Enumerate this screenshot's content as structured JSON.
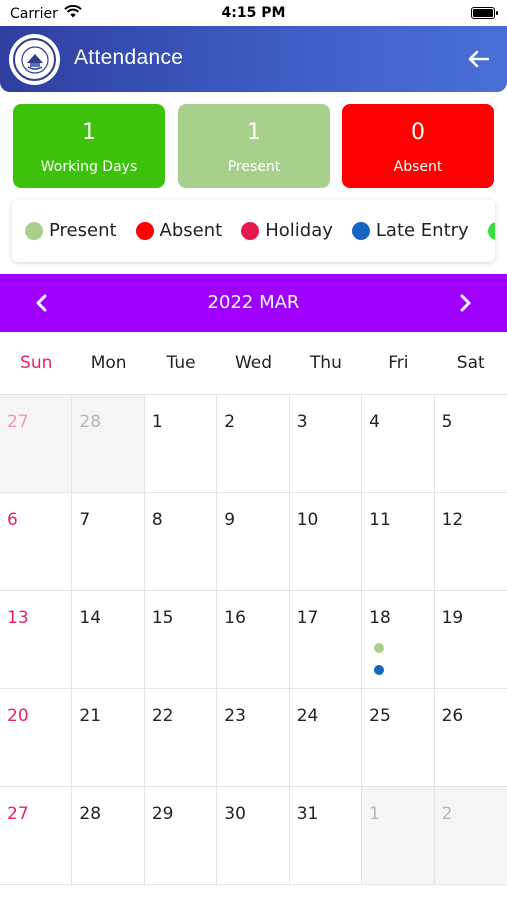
{
  "status_bar": {
    "carrier": "Carrier",
    "time": "4:15 PM"
  },
  "header": {
    "title": "Attendance",
    "logo_icon": "school-seal-icon",
    "back_icon": "arrow-left-icon"
  },
  "summary": [
    {
      "count": "1",
      "label": "Working Days",
      "color": "#3cc20a"
    },
    {
      "count": "1",
      "label": "Present",
      "color": "#a8d08d"
    },
    {
      "count": "0",
      "label": "Absent",
      "color": "#fe0000"
    }
  ],
  "legend": [
    {
      "label": "Present",
      "color": "#a8d08d"
    },
    {
      "label": "Absent",
      "color": "#fe0000"
    },
    {
      "label": "Holiday",
      "color": "#e8174f"
    },
    {
      "label": "Late Entry",
      "color": "#1565c0"
    },
    {
      "label": "",
      "color": "#3cdc3c"
    }
  ],
  "calendar": {
    "month_label": "2022 MAR",
    "accent": "#a000ff",
    "weekdays": [
      "Sun",
      "Mon",
      "Tue",
      "Wed",
      "Thu",
      "Fri",
      "Sat"
    ],
    "weeks": [
      [
        {
          "day": "27",
          "outside": true
        },
        {
          "day": "28",
          "outside": true
        },
        {
          "day": "1"
        },
        {
          "day": "2"
        },
        {
          "day": "3"
        },
        {
          "day": "4"
        },
        {
          "day": "5"
        }
      ],
      [
        {
          "day": "6"
        },
        {
          "day": "7"
        },
        {
          "day": "8"
        },
        {
          "day": "9"
        },
        {
          "day": "10"
        },
        {
          "day": "11"
        },
        {
          "day": "12"
        }
      ],
      [
        {
          "day": "13"
        },
        {
          "day": "14"
        },
        {
          "day": "15"
        },
        {
          "day": "16"
        },
        {
          "day": "17"
        },
        {
          "day": "18",
          "dots": [
            "#a8d08d",
            "#1565c0"
          ]
        },
        {
          "day": "19"
        }
      ],
      [
        {
          "day": "20"
        },
        {
          "day": "21"
        },
        {
          "day": "22"
        },
        {
          "day": "23"
        },
        {
          "day": "24"
        },
        {
          "day": "25"
        },
        {
          "day": "26"
        }
      ],
      [
        {
          "day": "27"
        },
        {
          "day": "28"
        },
        {
          "day": "29"
        },
        {
          "day": "30"
        },
        {
          "day": "31"
        },
        {
          "day": "1",
          "outside": true
        },
        {
          "day": "2",
          "outside": true
        }
      ]
    ]
  }
}
